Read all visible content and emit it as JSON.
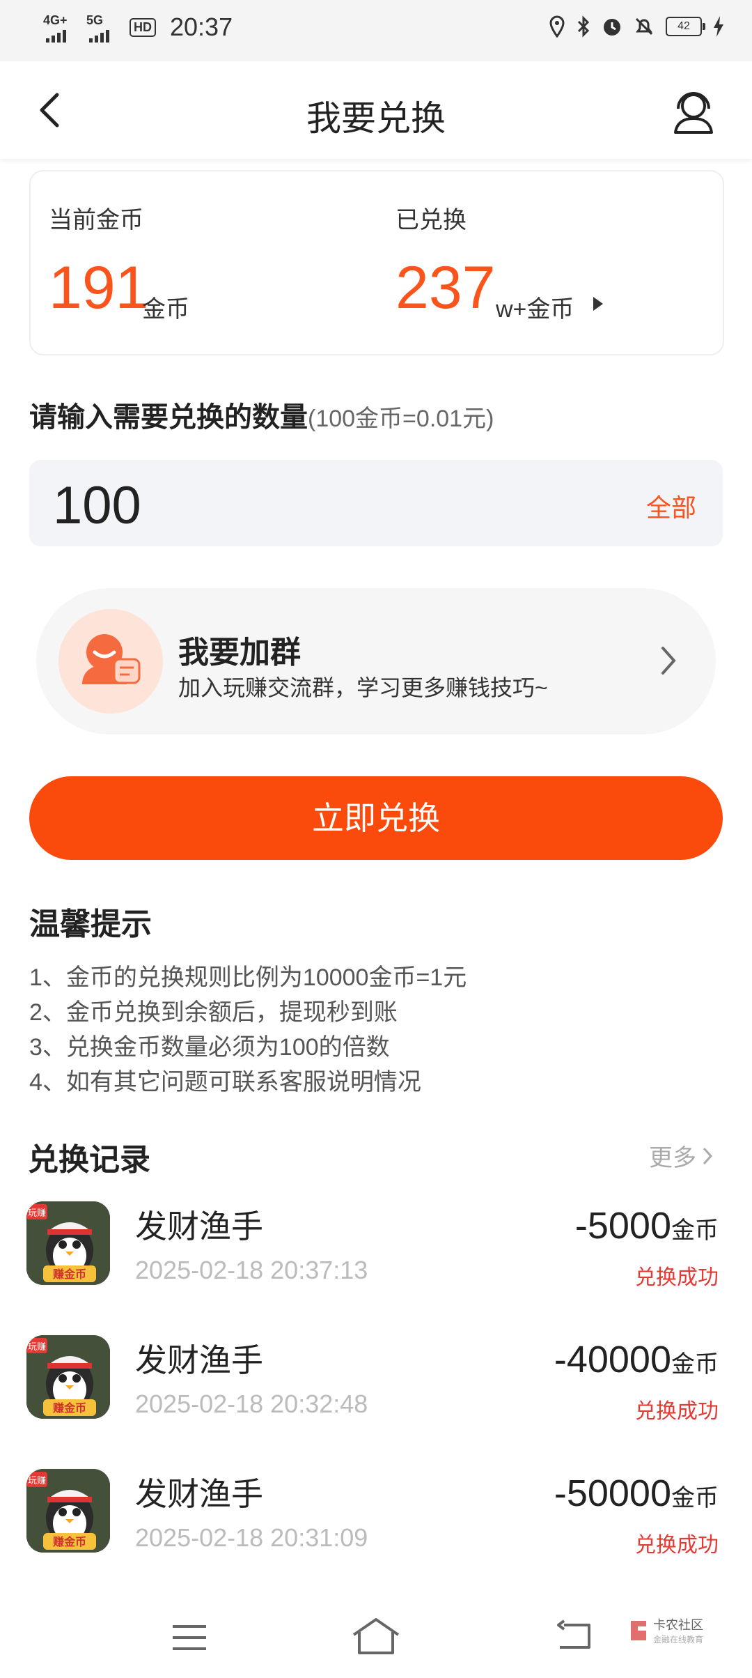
{
  "status_bar": {
    "signal1": "4G+",
    "signal2": "5G",
    "hd": "HD",
    "time": "20:37",
    "battery": "42"
  },
  "header": {
    "title": "我要兑换"
  },
  "balance": {
    "current_label": "当前金币",
    "current_value": "191",
    "current_unit": "金币",
    "exchanged_label": "已兑换",
    "exchanged_value": "237",
    "exchanged_unit": "w+金币"
  },
  "input_section": {
    "prompt": "请输入需要兑换的数量",
    "rate": "(100金币=0.01元)",
    "value": "100",
    "all_label": "全部"
  },
  "group_banner": {
    "title": "我要加群",
    "subtitle": "加入玩赚交流群，学习更多赚钱技巧~"
  },
  "exchange_button": "立即兑换",
  "tips": {
    "title": "温馨提示",
    "items": [
      "1、金币的兑换规则比例为10000金币=1元",
      "2、金币兑换到余额后，提现秒到账",
      "3、兑换金币数量必须为100的倍数",
      "4、如有其它问题可联系客服说明情况"
    ]
  },
  "records": {
    "title": "兑换记录",
    "more_label": "更多",
    "items": [
      {
        "app": "发财渔手",
        "time": "2025-02-18 20:37:13",
        "amount": "-5000",
        "unit": "金币",
        "status": "兑换成功",
        "badge_top": "玩赚",
        "badge_bottom": "赚金币"
      },
      {
        "app": "发财渔手",
        "time": "2025-02-18 20:32:48",
        "amount": "-40000",
        "unit": "金币",
        "status": "兑换成功",
        "badge_top": "玩赚",
        "badge_bottom": "赚金币"
      },
      {
        "app": "发财渔手",
        "time": "2025-02-18 20:31:09",
        "amount": "-50000",
        "unit": "金币",
        "status": "兑换成功",
        "badge_top": "玩赚",
        "badge_bottom": "赚金币"
      }
    ]
  },
  "watermark": {
    "line1": "卡农社区",
    "line2": "金融在线教育"
  },
  "colors": {
    "accent": "#fa541c",
    "button": "#fa4a0c",
    "success": "#e53935"
  }
}
